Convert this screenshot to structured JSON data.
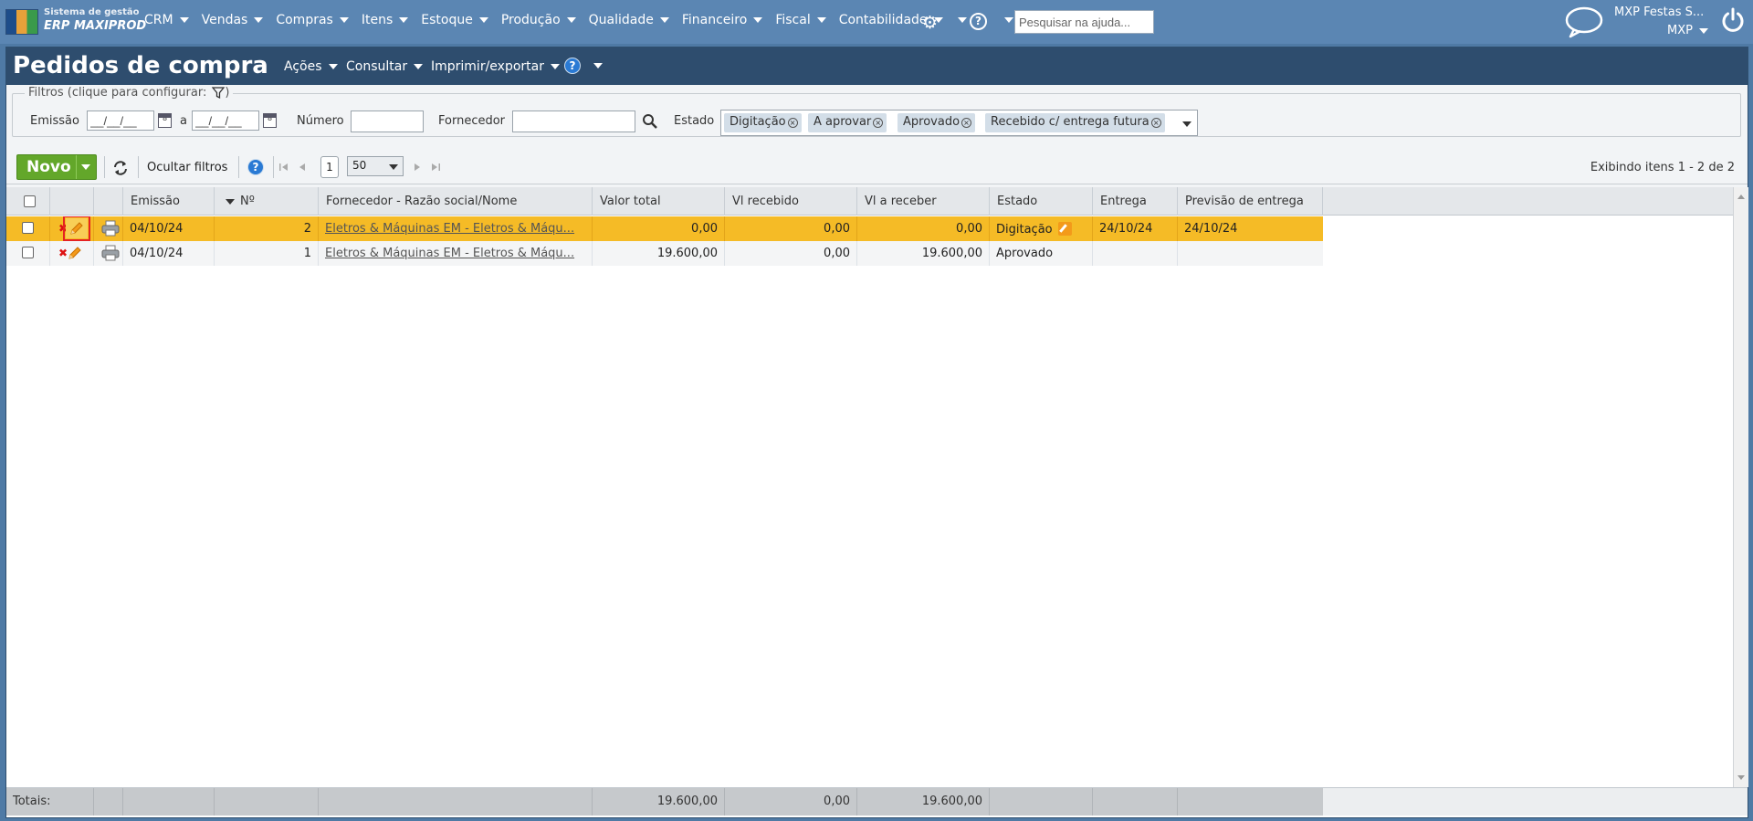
{
  "app": {
    "logo_line1": "Sistema de gestão",
    "logo_line2": "ERP MAXIPROD"
  },
  "nav": {
    "items": [
      {
        "label": "CRM"
      },
      {
        "label": "Vendas"
      },
      {
        "label": "Compras"
      },
      {
        "label": "Itens"
      },
      {
        "label": "Estoque"
      },
      {
        "label": "Produção"
      },
      {
        "label": "Qualidade"
      },
      {
        "label": "Financeiro"
      },
      {
        "label": "Fiscal"
      },
      {
        "label": "Contabilidade"
      }
    ],
    "help_search_placeholder": "Pesquisar na ajuda...",
    "user_name": "MXP Festas S...",
    "user_org": "MXP"
  },
  "page": {
    "title": "Pedidos de compra",
    "menus": {
      "acoes": "Ações",
      "consultar": "Consultar",
      "imprimir": "Imprimir/exportar"
    }
  },
  "filters": {
    "legend": "Filtros (clique para configurar:",
    "legend_close": ")",
    "emissao_label": "Emissão",
    "date_from": "__/__/__",
    "date_sep": "a",
    "date_to": "__/__/__",
    "numero_label": "Número",
    "numero_value": "",
    "fornecedor_label": "Fornecedor",
    "fornecedor_value": "",
    "estado_label": "Estado",
    "estado_chips": [
      "Digitação",
      "A aprovar",
      "Aprovado",
      "Recebido c/ entrega futura"
    ]
  },
  "toolbar": {
    "novo_label": "Novo",
    "ocultar_filtros": "Ocultar filtros",
    "page_number": "1",
    "page_size": "50",
    "showing": "Exibindo itens 1 - 2 de 2"
  },
  "grid": {
    "columns": {
      "emissao": "Emissão",
      "numero": "Nº",
      "fornecedor": "Fornecedor - Razão social/Nome",
      "valor_total": "Valor total",
      "vl_recebido": "Vl recebido",
      "vl_a_receber": "Vl a receber",
      "estado": "Estado",
      "entrega": "Entrega",
      "previsao": "Previsão de entrega"
    },
    "rows": [
      {
        "emissao": "04/10/24",
        "numero": "2",
        "fornecedor": "Eletros & Máquinas EM - Eletros & Máqu...",
        "valor_total": "0,00",
        "vl_recebido": "0,00",
        "vl_a_receber": "0,00",
        "estado": "Digitação",
        "entrega": "24/10/24",
        "previsao": "24/10/24"
      },
      {
        "emissao": "04/10/24",
        "numero": "1",
        "fornecedor": "Eletros & Máquinas EM - Eletros & Máqu...",
        "valor_total": "19.600,00",
        "vl_recebido": "0,00",
        "vl_a_receber": "19.600,00",
        "estado": "Aprovado",
        "entrega": "",
        "previsao": ""
      }
    ],
    "totals": {
      "label": "Totais:",
      "valor_total": "19.600,00",
      "vl_recebido": "0,00",
      "vl_a_receber": "19.600,00"
    }
  },
  "colors": {
    "nav_bg": "#5b86b3",
    "title_bg": "#2e4d6e",
    "selected_row": "#f5bb26",
    "novo_green": "#63a72a"
  }
}
